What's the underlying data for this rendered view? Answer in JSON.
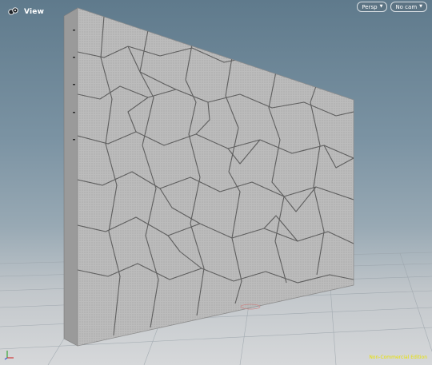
{
  "viewport": {
    "title": "View",
    "title_icon": "viewport-eye-icon",
    "camera_mode": "Persp",
    "camera_select": "No cam",
    "dropdown_icon": "chevron-down-icon",
    "watermark": "Non-Commercial Edition",
    "axes_icon": "xyz-axes-icon"
  },
  "scene": {
    "object": "wall-slab",
    "surface": "voronoi-cracked mesh",
    "colors": {
      "sky_top": "#5f7a8c",
      "ground": "#d6d8da",
      "wall_face": "#b8b8b8",
      "wall_edge": "#8e8e8e",
      "crack": "#5a5a5a",
      "watermark": "#e8e100"
    }
  }
}
